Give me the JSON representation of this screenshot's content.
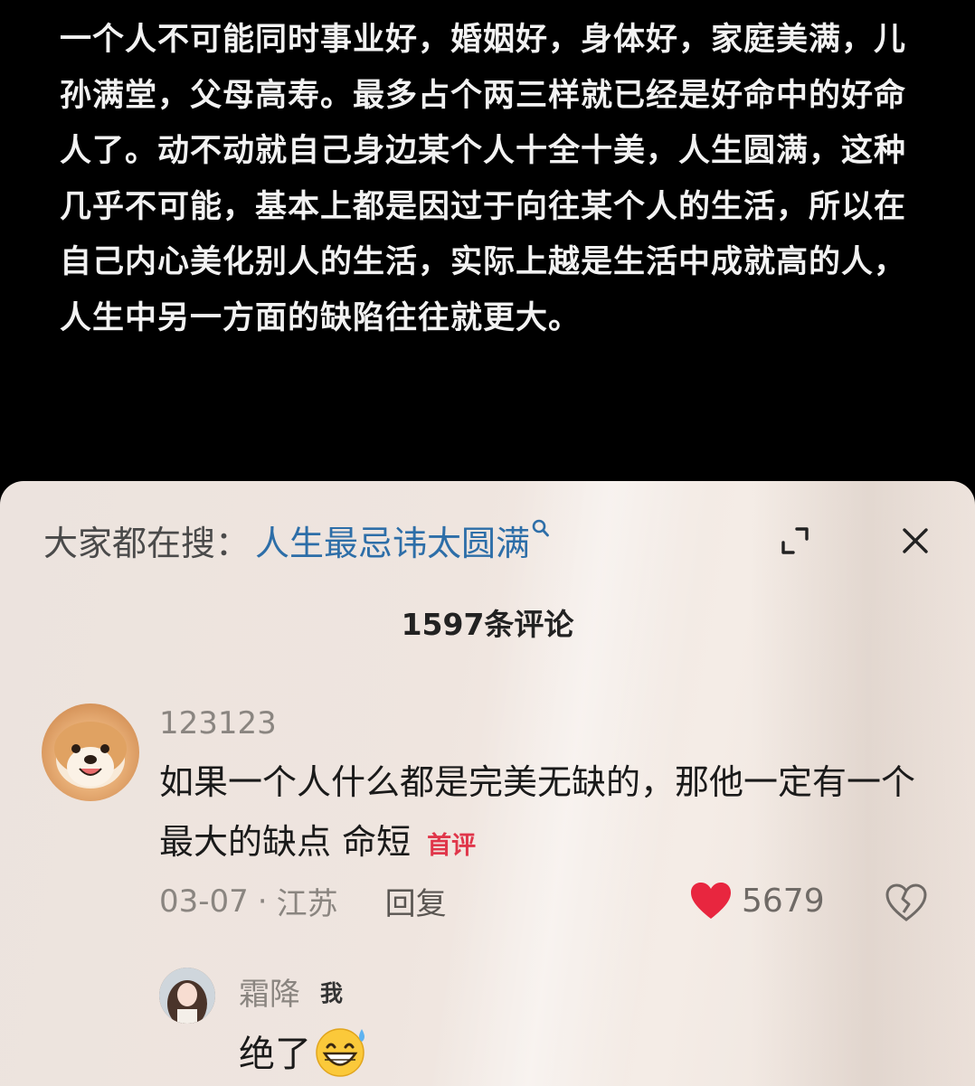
{
  "video": {
    "caption": "一个人不可能同时事业好，婚姻好，身体好，家庭美满，儿孙满堂，父母高寿。最多占个两三样就已经是好命中的好命人了。动不动就自己身边某个人十全十美，人生圆满，这种几乎不可能，基本上都是因过于向往某个人的生活，所以在自己内心美化别人的生活，实际上越是生活中成就高的人，人生中另一方面的缺陷往往就更大。"
  },
  "comments_panel": {
    "search": {
      "prefix": "大家都在搜：",
      "term": "人生最忌讳太圆满",
      "icon": "search-icon"
    },
    "expand_icon": "expand-icon",
    "close_icon": "close-icon",
    "count_label": "1597条评论",
    "comment": {
      "username": "123123",
      "text": "如果一个人什么都是完美无缺的，那他一定有一个最大的缺点 命短",
      "badge": "首评",
      "date": "03-07",
      "separator": "·",
      "location": "江苏",
      "reply_label": "回复",
      "like_count": "5679",
      "avatar": "shiba-dog-avatar"
    },
    "reply": {
      "username": "霜降",
      "badge": "我",
      "text": "绝了",
      "emoji": "grinning-sweat-emoji",
      "avatar": "girl-avatar"
    }
  },
  "colors": {
    "search_term": "#2d6ea8",
    "badge_red": "#e0364a",
    "heart_red": "#e8263f",
    "panel_bg": "#efe5df"
  }
}
